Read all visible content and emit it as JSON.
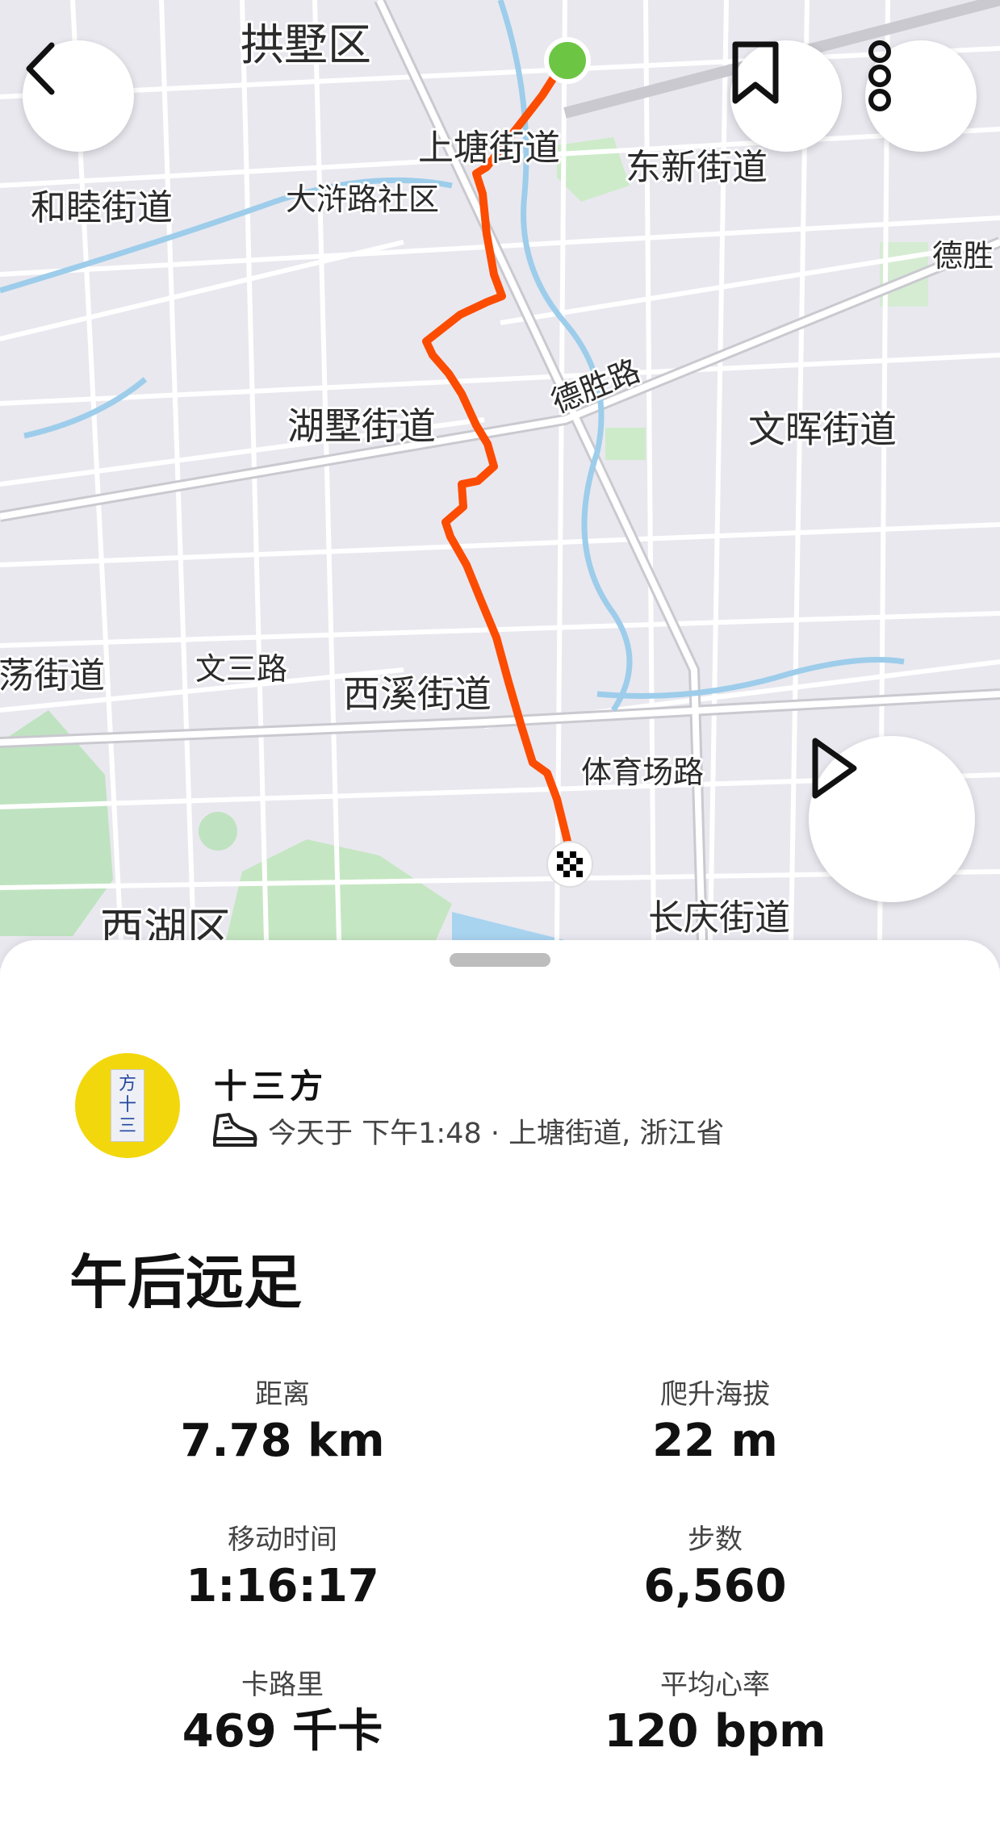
{
  "map": {
    "labels": {
      "gongshu": "拱墅区",
      "shangtang": "上塘街道",
      "dongxin": "东新街道",
      "hemu": "和睦街道",
      "daxulu": "大浒路社区",
      "desheng_edge": "德胜",
      "deshenglu": "德胜路",
      "hushu": "湖墅街道",
      "wenhui": "文晖街道",
      "dang": "荡街道",
      "wensanlu": "文三路",
      "xixi": "西溪街道",
      "tiyuchanglu": "体育场路",
      "xihu": "西湖区",
      "changqing": "长庆街道"
    },
    "route_color": "#fc4c02",
    "start_color": "#6cc644"
  },
  "buttons": {
    "back": "back",
    "bookmark": "bookmark",
    "more": "more",
    "play": "play"
  },
  "activity": {
    "user_name": "十三方",
    "avatar_text": [
      "方",
      "十",
      "三"
    ],
    "meta": "今天于 下午1:48 · 上塘街道, 浙江省",
    "title": "午后远足"
  },
  "stats": {
    "distance": {
      "label": "距离",
      "value": "7.78 km"
    },
    "elevation": {
      "label": "爬升海拔",
      "value": "22 m"
    },
    "moving_time": {
      "label": "移动时间",
      "value": "1:16:17"
    },
    "steps": {
      "label": "步数",
      "value": "6,560"
    },
    "calories": {
      "label": "卡路里",
      "value": "469 千卡"
    },
    "avg_hr": {
      "label": "平均心率",
      "value": "120 bpm"
    }
  }
}
